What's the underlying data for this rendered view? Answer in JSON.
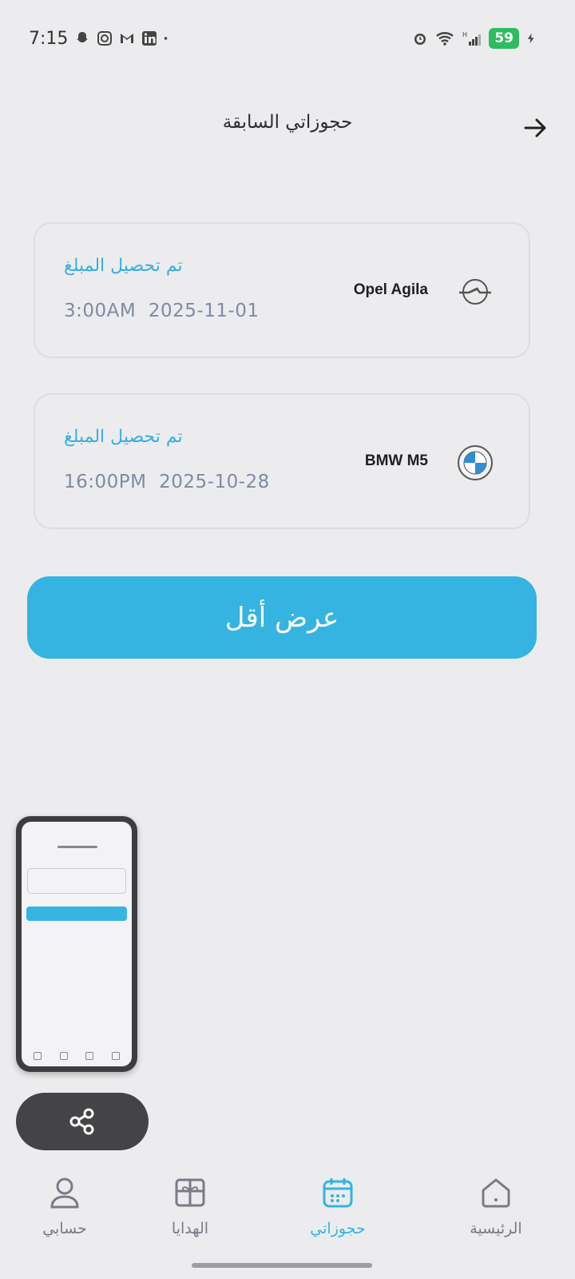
{
  "status_bar": {
    "time": "7:15",
    "battery": "59"
  },
  "header": {
    "title": "حجوزاتي السابقة"
  },
  "bookings": [
    {
      "status": "تم تحصيل المبلغ",
      "date": "2025-11-01",
      "time": "3:00AM",
      "model": "Opel Agila",
      "logo": "opel-logo"
    },
    {
      "status": "تم تحصيل المبلغ",
      "date": "2025-10-28",
      "time": "16:00PM",
      "model": "BMW M5",
      "logo": "bmw-logo"
    }
  ],
  "show_less_label": "عرض أقل",
  "bottom_nav": {
    "account": "حسابي",
    "gifts": "الهدايا",
    "bookings": "حجوزاتي",
    "home": "الرئيسية",
    "active": "bookings"
  },
  "colors": {
    "accent": "#35b4e2",
    "background": "#ececee",
    "date_text": "#7f8aa3"
  }
}
